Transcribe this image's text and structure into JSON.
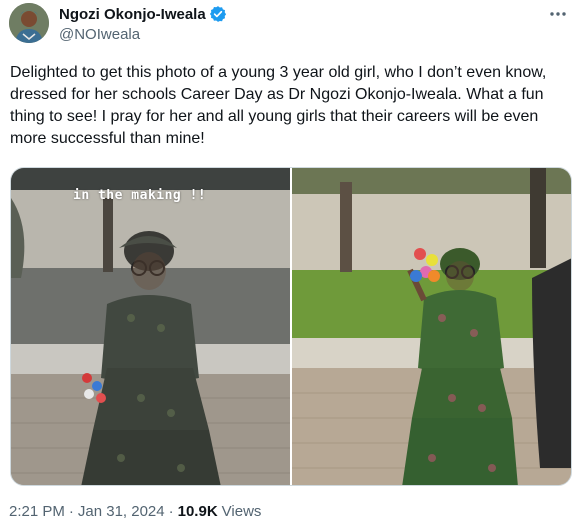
{
  "author": {
    "display_name": "Ngozi Okonjo-Iweala",
    "handle": "@NOIweala",
    "verified_icon": "verified-badge-icon",
    "verified_color": "#1d9bf0"
  },
  "tweet": {
    "text": "Delighted to get this photo of a young 3 year old girl, who I don’t even know, dressed for her schools Career Day as Dr Ngozi Okonjo-Iweala. What a fun thing to see! I pray for her and all young girls that their careers will be even more successful than mine!"
  },
  "media": {
    "left_overlay_text": "in the making !!"
  },
  "meta": {
    "time": "2:21 PM",
    "date": "Jan 31, 2024",
    "separator": "·",
    "views_count": "10.9K",
    "views_label": "Views"
  },
  "colors": {
    "text_primary": "#0f1419",
    "text_secondary": "#536471",
    "accent": "#1d9bf0"
  }
}
